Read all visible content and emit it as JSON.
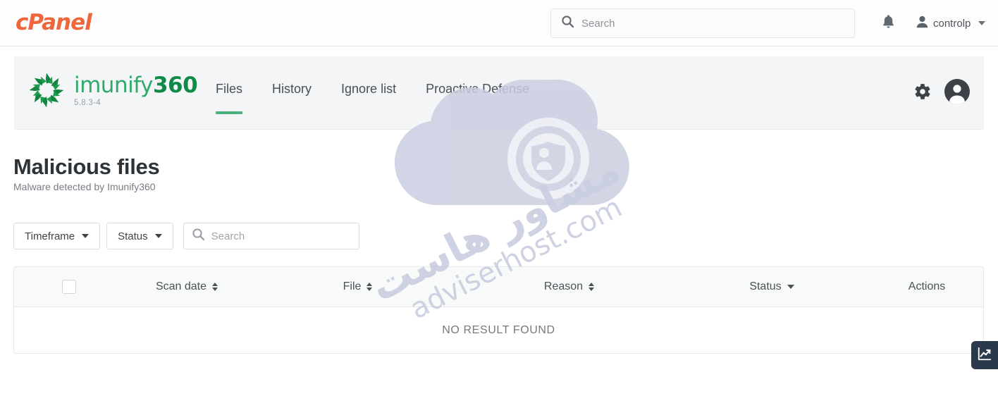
{
  "cpanel": {
    "logo_text": "cPanel",
    "search": {
      "placeholder": "Search",
      "value": ""
    },
    "notifications_icon": "bell-icon",
    "user": {
      "name": "controlp",
      "icon": "user-icon",
      "caret": "chevron-down-icon"
    }
  },
  "imunify": {
    "brand_light": "imunify",
    "brand_bold": "360",
    "version": "5.8.3-4",
    "nav": [
      {
        "label": "Files",
        "active": true
      },
      {
        "label": "History",
        "active": false
      },
      {
        "label": "Ignore list",
        "active": false
      },
      {
        "label": "Proactive Defense",
        "active": false
      }
    ],
    "settings_icon": "gear-icon",
    "account_icon": "avatar-icon"
  },
  "page": {
    "title": "Malicious files",
    "subtitle": "Malware detected by Imunify360"
  },
  "filters": {
    "timeframe_label": "Timeframe",
    "status_label": "Status",
    "search": {
      "placeholder": "Search",
      "value": ""
    }
  },
  "table": {
    "columns": [
      {
        "label": "",
        "sort": "none",
        "type": "checkbox"
      },
      {
        "label": "Scan date",
        "sort": "both"
      },
      {
        "label": "File",
        "sort": "both"
      },
      {
        "label": "Reason",
        "sort": "both"
      },
      {
        "label": "Status",
        "sort": "down"
      },
      {
        "label": "Actions",
        "sort": "none"
      }
    ],
    "rows": [],
    "empty_message": "NO RESULT FOUND"
  },
  "widget": {
    "icon": "line-chart-icon"
  },
  "watermark": {
    "text": "adviserhost.com"
  },
  "colors": {
    "cpanel_orange": "#f0663c",
    "imunify_green_light": "#2faa6a",
    "imunify_green_bold": "#0f8a47",
    "active_tab_underline": "#4caf7d",
    "panel_bg": "#f4f5f6",
    "table_header_bg": "#f8f9f9",
    "widget_bg": "#2b3a4a",
    "watermark_color": "#c8cee0"
  }
}
